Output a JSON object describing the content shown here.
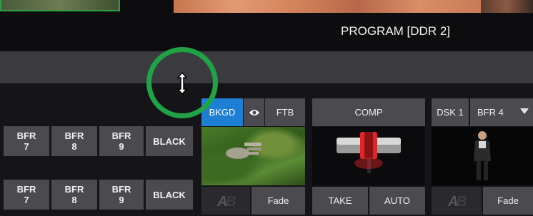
{
  "program_monitor": {
    "label": "PROGRAM [DDR 2]"
  },
  "bus_row_1": [
    "BFR\n7",
    "BFR\n8",
    "BFR\n9",
    "BLACK"
  ],
  "bus_row_2": [
    "BFR\n7",
    "BFR\n8",
    "BFR\n9",
    "BLACK"
  ],
  "background_group": {
    "tab_bkgd": "BKGD",
    "tab_ftb": "FTB",
    "fade_label": "Fade"
  },
  "transition_group": {
    "comp_label": "COMP",
    "take_label": "TAKE",
    "auto_label": "AUTO"
  },
  "dsk_group": {
    "dsk_label": "DSK 1",
    "source_label": "BFR 4",
    "fade_label": "Fade"
  },
  "colors": {
    "accent": "#1c7fd4",
    "focus_circle": "#1fa346",
    "tbar_red": "#e0262b"
  }
}
